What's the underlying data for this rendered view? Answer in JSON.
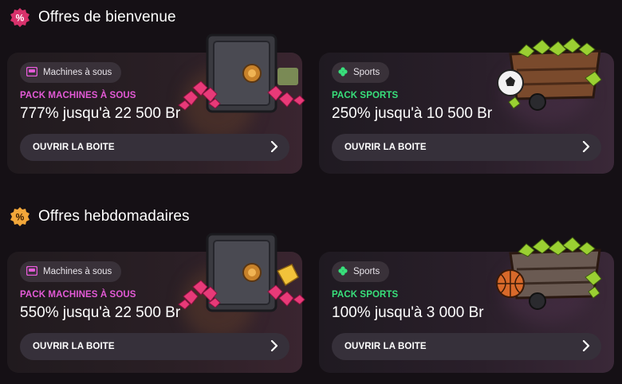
{
  "sections": [
    {
      "title": "Offres de bienvenue",
      "cards": [
        {
          "tag": "Machines à sous",
          "pack": "PACK MACHINES À SOUS",
          "amount": "777% jusqu'à 22 500 Br",
          "button": "OUVRIR LA BOITE"
        },
        {
          "tag": "Sports",
          "pack": "PACK SPORTS",
          "amount": "250% jusqu'à 10 500 Br",
          "button": "OUVRIR LA BOITE"
        }
      ]
    },
    {
      "title": "Offres hebdomadaires",
      "cards": [
        {
          "tag": "Machines à sous",
          "pack": "PACK MACHINES À SOUS",
          "amount": "550% jusqu'à 22 500 Br",
          "button": "OUVRIR LA BOITE"
        },
        {
          "tag": "Sports",
          "pack": "PACK SPORTS",
          "amount": "100% jusqu'à 3 000 Br",
          "button": "OUVRIR LA BOITE"
        }
      ]
    }
  ],
  "icons": {
    "welcome_badge": "percent-badge-icon",
    "weekly_badge": "percent-star-badge-icon",
    "slots_tag": "slot-machine-icon",
    "sports_tag": "clover-icon",
    "button_arrow": "chevron-right-icon"
  },
  "colors": {
    "background": "#151015",
    "slots_accent": "#e35ad6",
    "sports_accent": "#38e07b",
    "button_bg": "#36303a",
    "welcome_badge": "#d8316b",
    "weekly_badge": "#f2a73a"
  }
}
